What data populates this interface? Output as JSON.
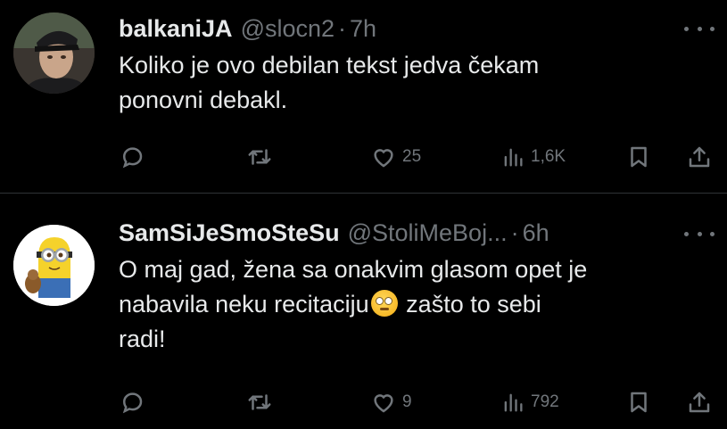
{
  "tweets": [
    {
      "display_name": "balkaniJA",
      "handle": "@slocn2",
      "separator": "·",
      "time": "7h",
      "text_lines": [
        "Koliko je ovo debilan tekst jedva čekam",
        "ponovni debakl."
      ],
      "likes": "25",
      "views": "1,6K",
      "avatar": "user-photo"
    },
    {
      "display_name": "SamSiJeSmoSteSu",
      "handle": "@StoliMeBoj...",
      "separator": "·",
      "time": "6h",
      "text_line1": "O maj gad, žena sa onakvim glasom opet je",
      "text_line2_before": "nabavila neku recitaciju",
      "emoji": "face-with-rolling-eyes",
      "text_line2_after": " zašto to sebi",
      "text_line3": "radi!",
      "likes": "9",
      "views": "792",
      "avatar": "minion-cartoon"
    }
  ],
  "icons": [
    "reply-icon",
    "retweet-icon",
    "like-icon",
    "views-icon",
    "bookmark-icon",
    "share-icon",
    "more-icon"
  ],
  "colors": {
    "background": "#000000",
    "text": "#e7e9ea",
    "muted": "#71767b",
    "divider": "#2f3336"
  }
}
